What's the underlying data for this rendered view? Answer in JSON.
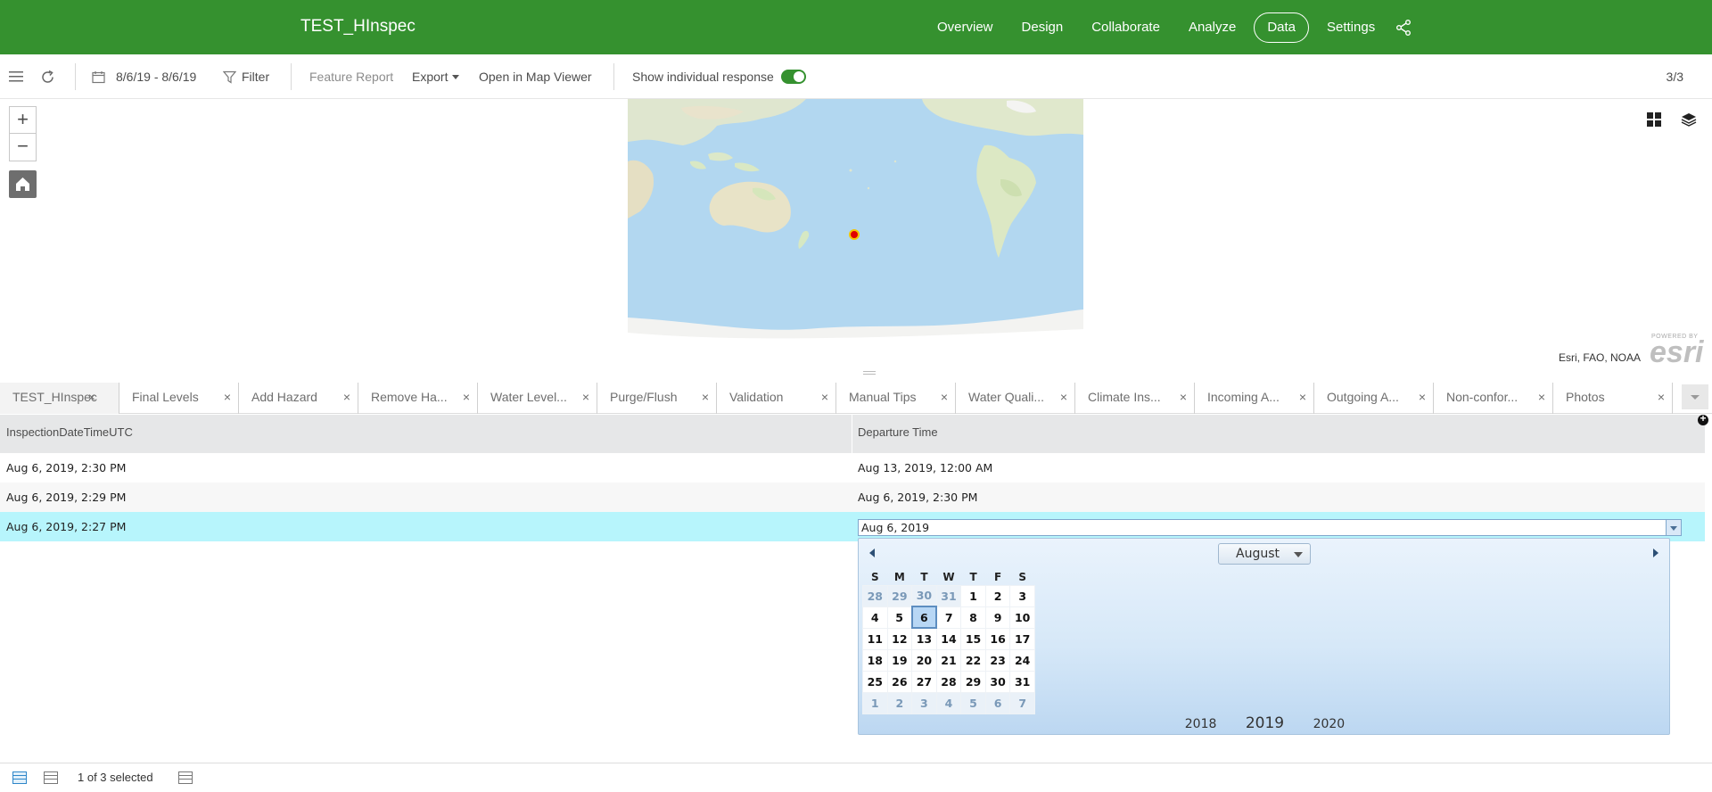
{
  "header": {
    "app_title": "TEST_HInspec",
    "nav": [
      {
        "label": "Overview"
      },
      {
        "label": "Design"
      },
      {
        "label": "Collaborate"
      },
      {
        "label": "Analyze"
      },
      {
        "label": "Data",
        "active": true
      },
      {
        "label": "Settings"
      }
    ],
    "brand_color": "#35912f"
  },
  "toolbar": {
    "date_range": "8/6/19 - 8/6/19",
    "filter_label": "Filter",
    "feature_report_label": "Feature Report",
    "export_label": "Export",
    "open_map_label": "Open in Map Viewer",
    "show_individual_label": "Show individual response",
    "show_individual_on": true,
    "record_counter": "3/3"
  },
  "map": {
    "zoom_in": "+",
    "zoom_out": "−",
    "attribution": "Esri, FAO, NOAA",
    "logo_caption": "POWERED BY",
    "logo_word": "esri",
    "marker_color": "#e00000"
  },
  "tabs": [
    {
      "label": "TEST_HInspec",
      "active": true
    },
    {
      "label": "Final Levels"
    },
    {
      "label": "Add Hazard"
    },
    {
      "label": "Remove Ha..."
    },
    {
      "label": "Water Level..."
    },
    {
      "label": "Purge/Flush"
    },
    {
      "label": "Validation"
    },
    {
      "label": "Manual Tips"
    },
    {
      "label": "Water Quali..."
    },
    {
      "label": "Climate Ins..."
    },
    {
      "label": "Incoming A..."
    },
    {
      "label": "Outgoing A..."
    },
    {
      "label": "Non-confor..."
    },
    {
      "label": "Photos"
    }
  ],
  "table": {
    "columns": [
      "InspectionDateTimeUTC",
      "Departure Time"
    ],
    "rows": [
      [
        "Aug 6, 2019, 2:30 PM",
        "Aug 13, 2019, 12:00 AM"
      ],
      [
        "Aug 6, 2019, 2:29 PM",
        "Aug 6, 2019, 2:30 PM"
      ],
      [
        "Aug 6, 2019, 2:27 PM",
        ""
      ]
    ],
    "selected_row": 2,
    "selected_color": "#b7f5fc"
  },
  "date_editor": {
    "value": "Aug 6, 2019",
    "month": "August",
    "weekdays": [
      "S",
      "M",
      "T",
      "W",
      "T",
      "F",
      "S"
    ],
    "weeks": [
      [
        "28",
        "29",
        "30",
        "31",
        "1",
        "2",
        "3"
      ],
      [
        "4",
        "5",
        "6",
        "7",
        "8",
        "9",
        "10"
      ],
      [
        "11",
        "12",
        "13",
        "14",
        "15",
        "16",
        "17"
      ],
      [
        "18",
        "19",
        "20",
        "21",
        "22",
        "23",
        "24"
      ],
      [
        "25",
        "26",
        "27",
        "28",
        "29",
        "30",
        "31"
      ],
      [
        "1",
        "2",
        "3",
        "4",
        "5",
        "6",
        "7"
      ]
    ],
    "selected_day": "6",
    "years": [
      "2018",
      "2019",
      "2020"
    ],
    "current_year": "2019"
  },
  "footer": {
    "selection_text": "1 of 3 selected"
  }
}
